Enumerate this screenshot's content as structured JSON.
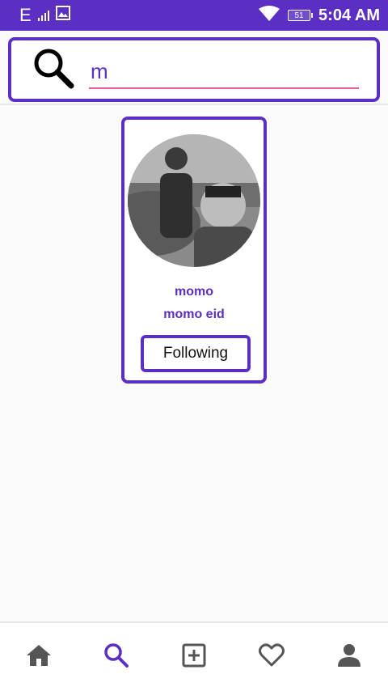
{
  "status_bar": {
    "network": "E",
    "battery_level": "51",
    "time": "5:04 AM"
  },
  "search": {
    "value": "m",
    "placeholder": ""
  },
  "results": [
    {
      "username": "momo",
      "full_name": "momo eid",
      "follow_label": "Following"
    }
  ],
  "bottom_nav": [
    {
      "icon": "home-icon",
      "active": false
    },
    {
      "icon": "search-icon",
      "active": true
    },
    {
      "icon": "add-post-icon",
      "active": false
    },
    {
      "icon": "heart-icon",
      "active": false
    },
    {
      "icon": "profile-icon",
      "active": false
    }
  ],
  "colors": {
    "accent": "#5b2fc4",
    "input_underline": "#e5609a",
    "nav_inactive": "#555555"
  }
}
